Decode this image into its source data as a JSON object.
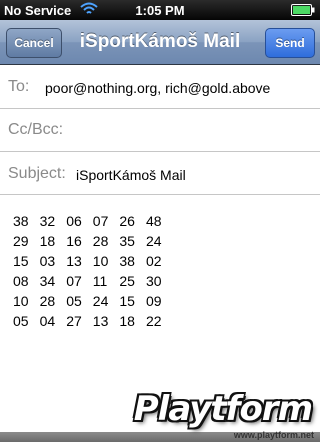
{
  "status_bar": {
    "carrier": "No Service",
    "time": "1:05 PM"
  },
  "nav": {
    "title": "iSportKámoš Mail",
    "cancel_label": "Cancel",
    "send_label": "Send"
  },
  "fields": {
    "to_label": "To:",
    "to_value": "poor@nothing.org, rich@gold.above",
    "cc_label": "Cc/Bcc:",
    "subject_label": "Subject:",
    "subject_value": "iSportKámoš Mail"
  },
  "body_rows": [
    [
      "38",
      "32",
      "06",
      "07",
      "26",
      "48"
    ],
    [
      "29",
      "18",
      "16",
      "28",
      "35",
      "24"
    ],
    [
      "15",
      "03",
      "13",
      "10",
      "38",
      "02"
    ],
    [
      "08",
      "34",
      "07",
      "11",
      "25",
      "30"
    ],
    [
      "10",
      "28",
      "05",
      "24",
      "15",
      "09"
    ],
    [
      "05",
      "04",
      "27",
      "13",
      "18",
      "22"
    ]
  ],
  "watermark": {
    "logo": "Playtform",
    "url": "www.playtform.net"
  },
  "colors": {
    "nav_top": "#b3c3d9",
    "nav_bottom": "#6d88af",
    "send_button": "#2f6ddb",
    "label_gray": "#8a8a8a"
  },
  "icons": {
    "wifi": "wifi-icon",
    "battery": "battery-icon"
  }
}
